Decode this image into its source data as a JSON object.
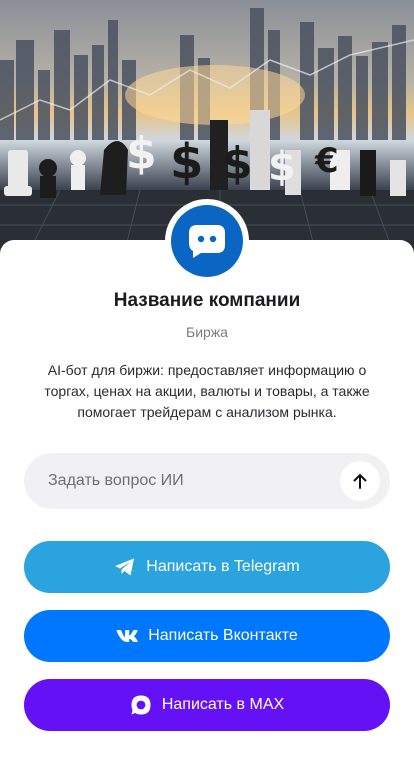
{
  "company": {
    "name": "Название компании",
    "category": "Биржа",
    "description": "AI-бот для биржи: предоставляет информацию о торгах, ценах на акции, валюты и товары, а также помогает трейдерам с анализом рынка.",
    "avatar_icon": "chat-bubble-icon",
    "brand_color": "#0a66c2"
  },
  "hero": {
    "image_subject": "chess pieces with currency symbols in front of a city skyline",
    "symbols": [
      "$",
      "$",
      "$",
      "$",
      "€"
    ]
  },
  "ask": {
    "placeholder": "Задать вопрос ИИ",
    "value": "",
    "send_icon": "arrow-up-icon"
  },
  "buttons": {
    "telegram": {
      "label": "Написать в Telegram",
      "icon": "telegram-icon",
      "color": "#2aa3df"
    },
    "vk": {
      "label": "Написать Вконтакте",
      "icon": "vk-icon",
      "color": "#0077ff"
    },
    "max": {
      "label": "Написать в MAX",
      "icon": "max-icon",
      "color": "#6511f5"
    }
  }
}
